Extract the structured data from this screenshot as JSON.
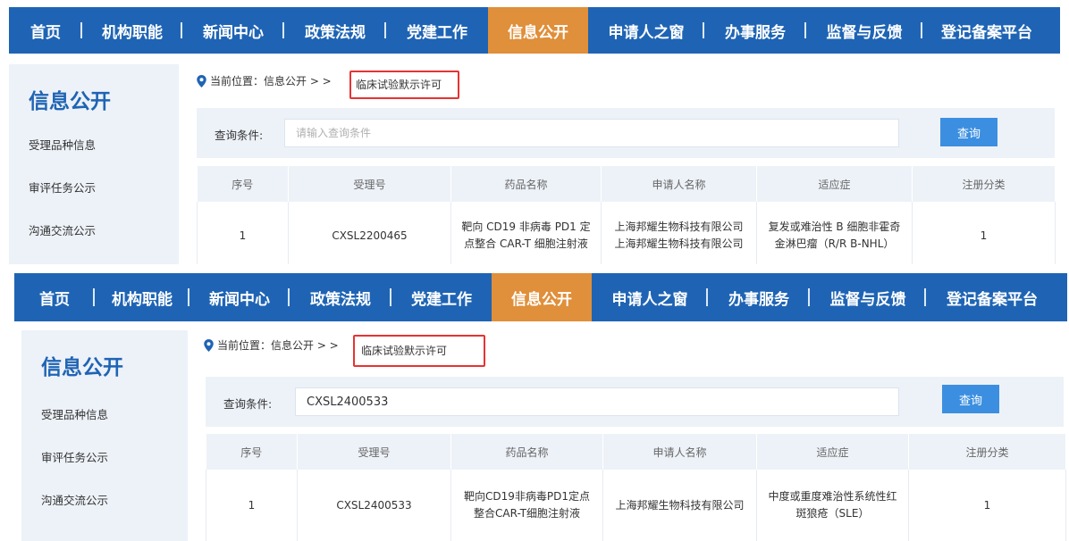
{
  "nav": {
    "items": [
      "首页",
      "机构职能",
      "新闻中心",
      "政策法规",
      "党建工作",
      "信息公开",
      "申请人之窗",
      "办事服务",
      "监督与反馈",
      "登记备案平台"
    ],
    "active_index": 5,
    "colors": {
      "bar": "#1f64b4",
      "active": "#e08f3a"
    }
  },
  "sidebar": {
    "title": "信息公开",
    "items": [
      "受理品种信息",
      "审评任务公示",
      "沟通交流公示"
    ]
  },
  "breadcrumb": {
    "prefix": "当前位置：信息公开 > >",
    "prefix_b": "当前位置：信息公开 > >",
    "current": "临床试验默示许可"
  },
  "search": {
    "label": "查询条件:",
    "placeholder": "请输入查询条件",
    "button": "查询",
    "value_b": "CXSL2400533"
  },
  "table": {
    "columns": [
      "序号",
      "受理号",
      "药品名称",
      "申请人名称",
      "适应症",
      "注册分类"
    ]
  },
  "rows_a": [
    {
      "index": "1",
      "accept_no": "CXSL2200465",
      "drug": "靶向 CD19 非病毒 PD1 定点整合 CAR-T 细胞注射液",
      "applicant": "上海邦耀生物科技有限公司上海邦耀生物科技有限公司",
      "indication": "复发或难治性 B 细胞非霍奇金淋巴瘤（R/R B-NHL）",
      "category": "1"
    }
  ],
  "rows_b": [
    {
      "index": "1",
      "accept_no": "CXSL2400533",
      "drug": "靶向CD19非病毒PD1定点整合CAR-T细胞注射液",
      "applicant": "上海邦耀生物科技有限公司",
      "indication": "中度或重度难治性系统性红斑狼疮（SLE）",
      "category": "1"
    }
  ],
  "colors": {
    "highlight": "#e53333",
    "button": "#3c8fe0",
    "soft": "#edf2f8"
  },
  "icons": {
    "breadcrumb": "location-pin-icon"
  }
}
